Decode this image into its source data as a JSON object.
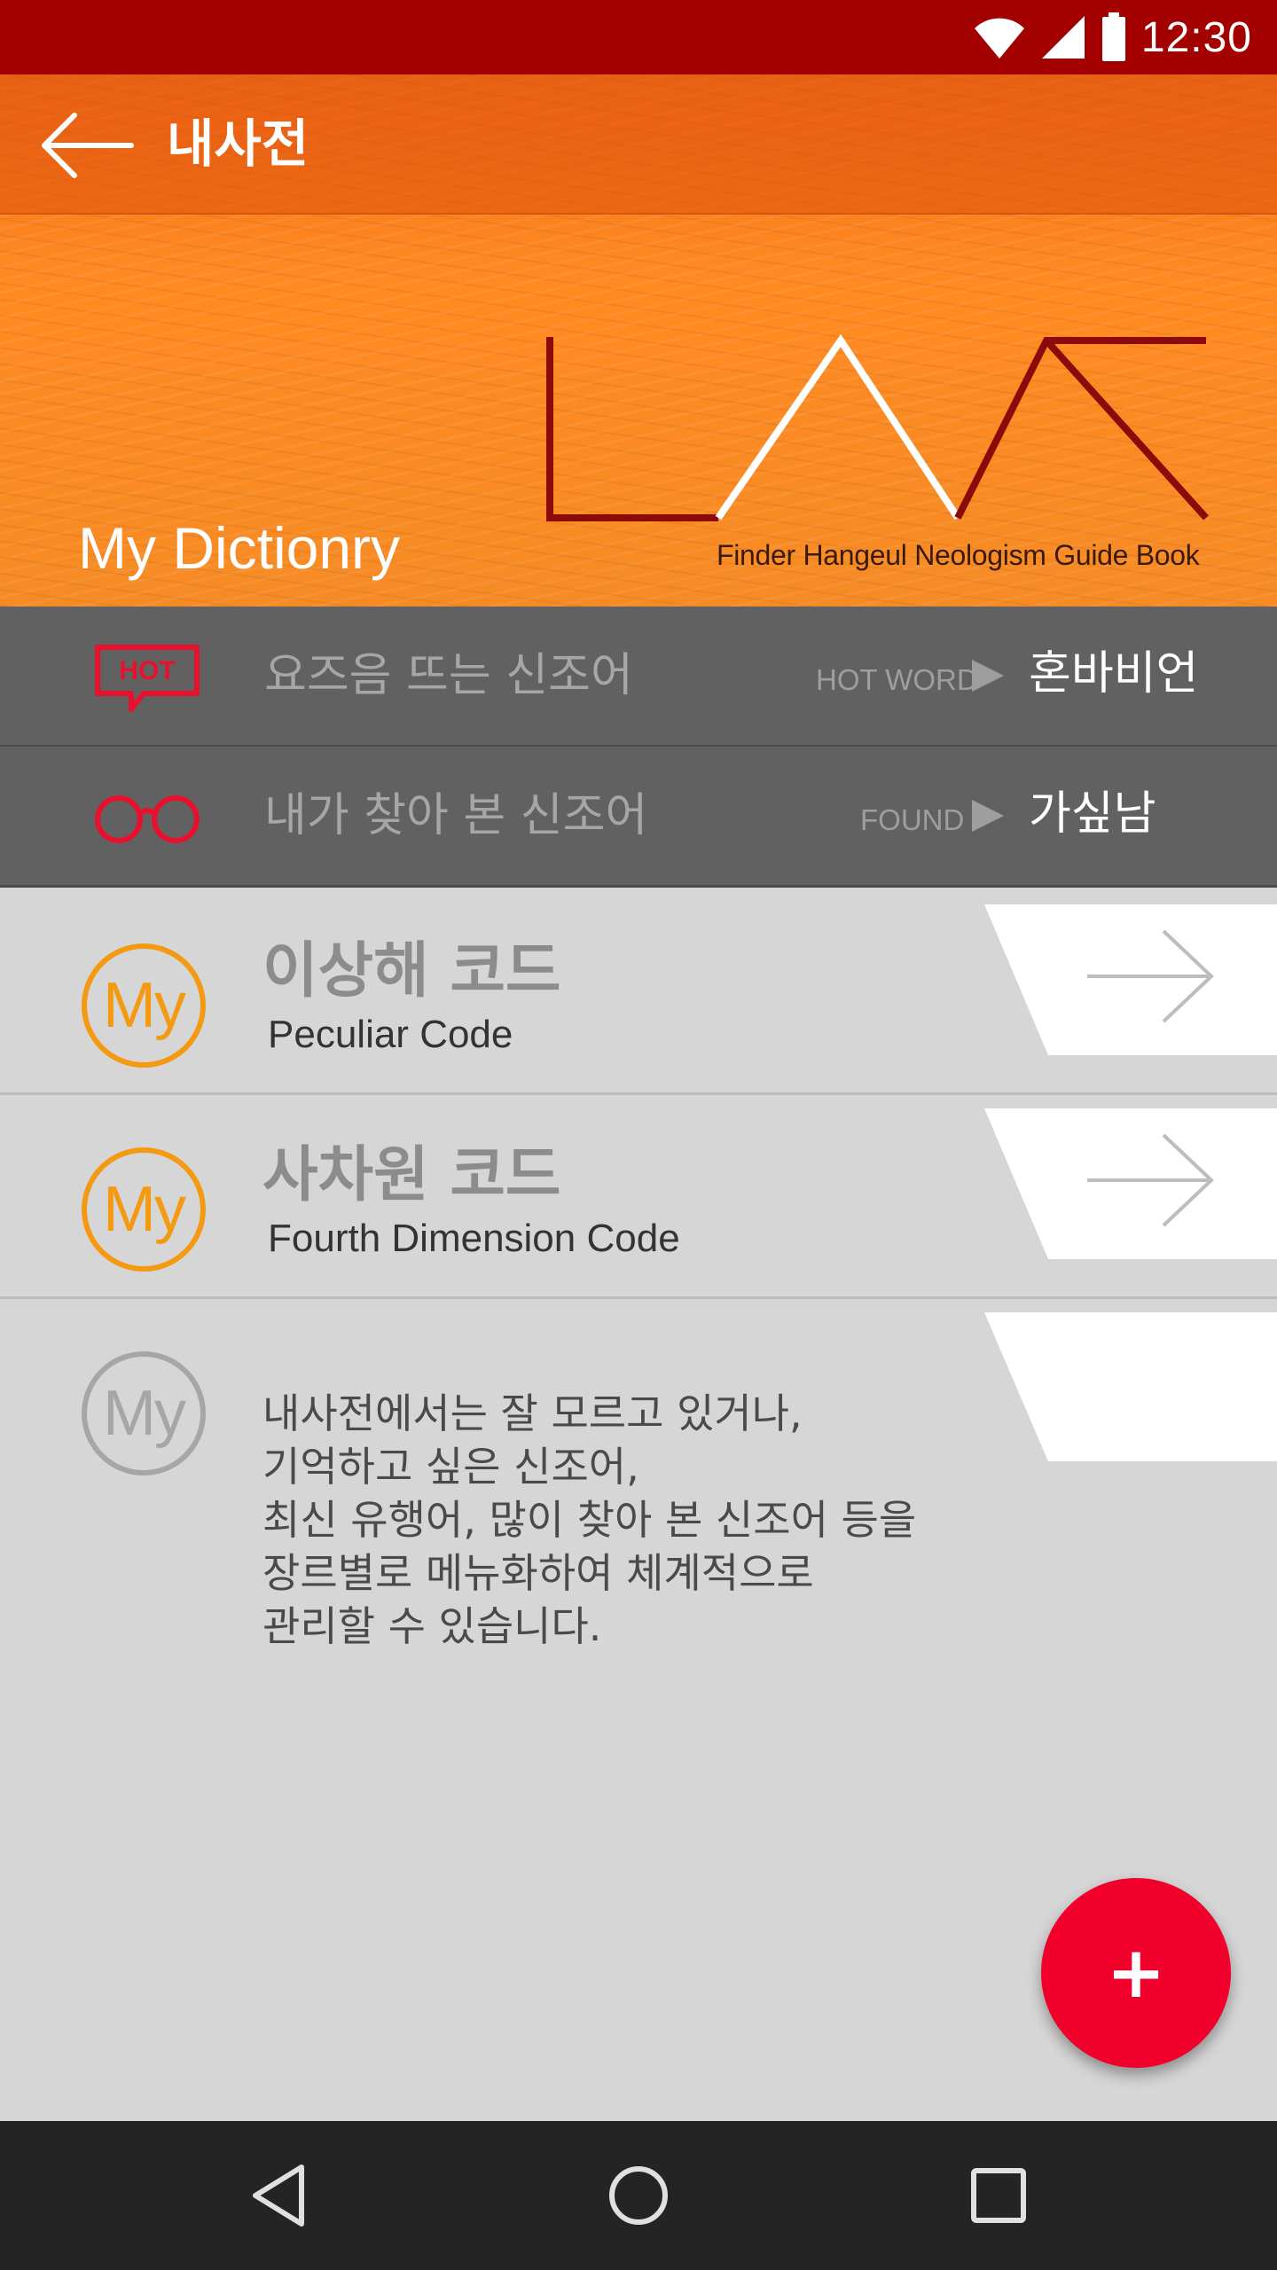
{
  "status_bar": {
    "time": "12:30",
    "icons": [
      "wifi-icon",
      "signal-icon",
      "battery-icon"
    ]
  },
  "app_bar": {
    "title": "내사전",
    "back_icon": "arrow-left-icon"
  },
  "banner": {
    "title": "My Dictionry",
    "logo_subtitle": "Finder Hangeul Neologism Guide Book"
  },
  "rows": [
    {
      "icon": "hot-badge-icon",
      "icon_text": "HOT",
      "label": "요즈음 뜨는 신조어",
      "tag": "HOT WORD",
      "value": "혼바비언"
    },
    {
      "icon": "glasses-icon",
      "label": "내가 찾아 본 신조어",
      "tag": "FOUND",
      "value": "가싶남"
    }
  ],
  "cards": [
    {
      "badge": "My",
      "title": "이상해 코드",
      "subtitle": "Peculiar Code"
    },
    {
      "badge": "My",
      "title": "사차원 코드",
      "subtitle": "Fourth Dimension Code"
    },
    {
      "badge": "My",
      "description": "내사전에서는 잘 모르고 있거나,\n기억하고 싶은 신조어,\n최신 유행어, 많이 찾아 본 신조어 등을\n장르별로 메뉴화하여 체계적으로\n관리할 수 있습니다."
    }
  ],
  "fab": {
    "label": "+"
  },
  "colors": {
    "status_bar": "#a30000",
    "header_orange": "#f68b25",
    "row_gray": "#616161",
    "accent_orange": "#f39a12",
    "fab_red": "#f0002a",
    "logo_dark_red": "#8b0a0a"
  }
}
